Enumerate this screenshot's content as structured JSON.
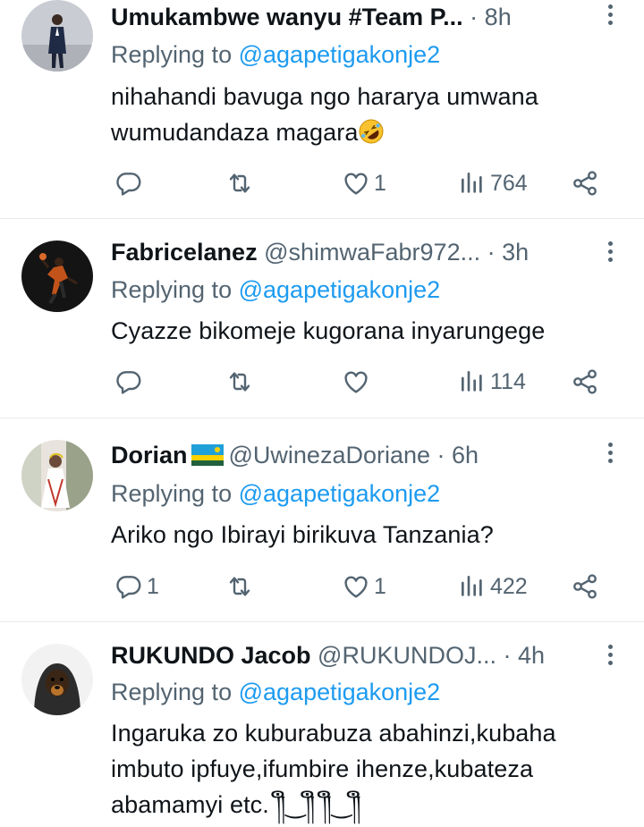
{
  "reply_prefix": "Replying to",
  "tweets": [
    {
      "name": "Umukambwe wanyu #Team P...",
      "handle": "",
      "time": "8h",
      "mention": "@agapetigakonje2",
      "text_lines": [
        "nihahandi bavuga ngo hararya umwana",
        "wumudandaza magara"
      ],
      "emoji": "rolling-on-floor-laughing",
      "replies": "",
      "retweets": "",
      "likes": "1",
      "views": "764"
    },
    {
      "name": "Fabricelanez",
      "handle": "@shimwaFabr972...",
      "time": "3h",
      "mention": "@agapetigakonje2",
      "text_lines": [
        "Cyazze bikomeje kugorana inyarungege"
      ],
      "replies": "",
      "retweets": "",
      "likes": "",
      "views": "114"
    },
    {
      "name": "Dorian",
      "flag": "rwanda-flag",
      "handle": "@UwinezaDoriane",
      "time": "6h",
      "mention": "@agapetigakonje2",
      "text_lines": [
        "Ariko ngo Ibirayi birikuva Tanzania?"
      ],
      "replies": "1",
      "retweets": "",
      "likes": "1",
      "views": "422"
    },
    {
      "name": "RUKUNDO Jacob",
      "handle": "@RUKUNDOJ...",
      "time": "4h",
      "mention": "@agapetigakonje2",
      "text_lines": [
        "Ingaruka zo kuburabuza abahinzi,kubaha",
        "imbuto ipfuye,ifumbire ihenze,kubateza",
        "abamamyi etc. ༎ຶ‿༎ຶ ༎ຶ‿༎ຶ"
      ],
      "replies": "",
      "retweets": "",
      "likes": "",
      "views": ""
    }
  ],
  "colors": {
    "text": "#0f1419",
    "muted": "#536471",
    "link": "#1d9bf0",
    "divider": "#e7e9ea"
  }
}
